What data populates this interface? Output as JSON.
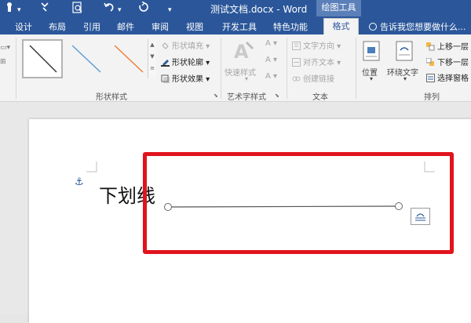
{
  "window": {
    "title": "测试文档.docx - Word",
    "context_tab": "绘图工具",
    "qat": {
      "save_icon": "save-icon",
      "touch_icon": "touch-mode-icon",
      "preview_icon": "print-preview-icon",
      "undo_icon": "undo-icon",
      "redo_icon": "redo-icon",
      "more_icon": "chevron-down-icon"
    }
  },
  "tabs": [
    {
      "label": "设计"
    },
    {
      "label": "布局"
    },
    {
      "label": "引用"
    },
    {
      "label": "邮件"
    },
    {
      "label": "审阅"
    },
    {
      "label": "视图"
    },
    {
      "label": "开发工具"
    },
    {
      "label": "特色功能"
    },
    {
      "label": "格式",
      "active": true
    }
  ],
  "tell_me": "告诉我您想要做什么...",
  "ribbon": {
    "shape_styles": {
      "label": "形状样式",
      "fill": "形状填充",
      "outline": "形状轮廓",
      "effects": "形状效果"
    },
    "wordart": {
      "label": "艺术字样式",
      "quick_styles": "快速样式"
    },
    "text": {
      "label": "文本",
      "direction": "文字方向",
      "align": "对齐文本",
      "link": "创建链接"
    },
    "arrange": {
      "label": "排列",
      "position": "位置",
      "wrap": "环绕文字",
      "forward": "上移一层",
      "backward": "下移一层",
      "pane": "选择窗格"
    }
  },
  "document": {
    "text": "下划线"
  },
  "colors": {
    "title_bar": "#2b579a",
    "highlight": "#e0141e",
    "gallery_line_1": "#333333",
    "gallery_line_2": "#5b9bd5",
    "gallery_line_3": "#ed7d31"
  }
}
